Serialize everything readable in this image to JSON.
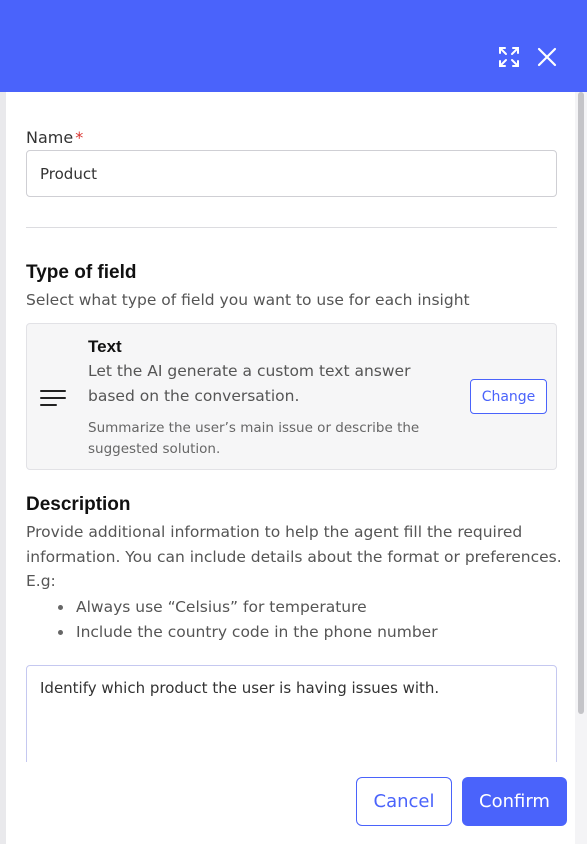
{
  "colors": {
    "accent": "#4a63fb",
    "required": "#d9322e"
  },
  "header": {
    "expand_icon": "expand-icon",
    "close_icon": "close-icon"
  },
  "name_field": {
    "label": "Name",
    "required_marker": "*",
    "value": "Product"
  },
  "type_section": {
    "title": "Type of field",
    "subtitle": "Select what type of field you want to use for each insight",
    "card": {
      "icon": "text-lines-icon",
      "title": "Text",
      "description": "Let the AI generate a custom text answer based on the conversation.",
      "hint": "Summarize the user’s main issue or describe the suggested solution.",
      "change_label": "Change"
    }
  },
  "description_section": {
    "title": "Description",
    "text": "Provide additional information to help the agent fill the required information. You can include details about the format or preferences. E.g:",
    "bullets": [
      "Always use “Celsius” for temperature",
      "Include the country code in the phone number"
    ],
    "textarea_value": "Identify which product the user is having issues with."
  },
  "footer": {
    "cancel_label": "Cancel",
    "confirm_label": "Confirm"
  }
}
